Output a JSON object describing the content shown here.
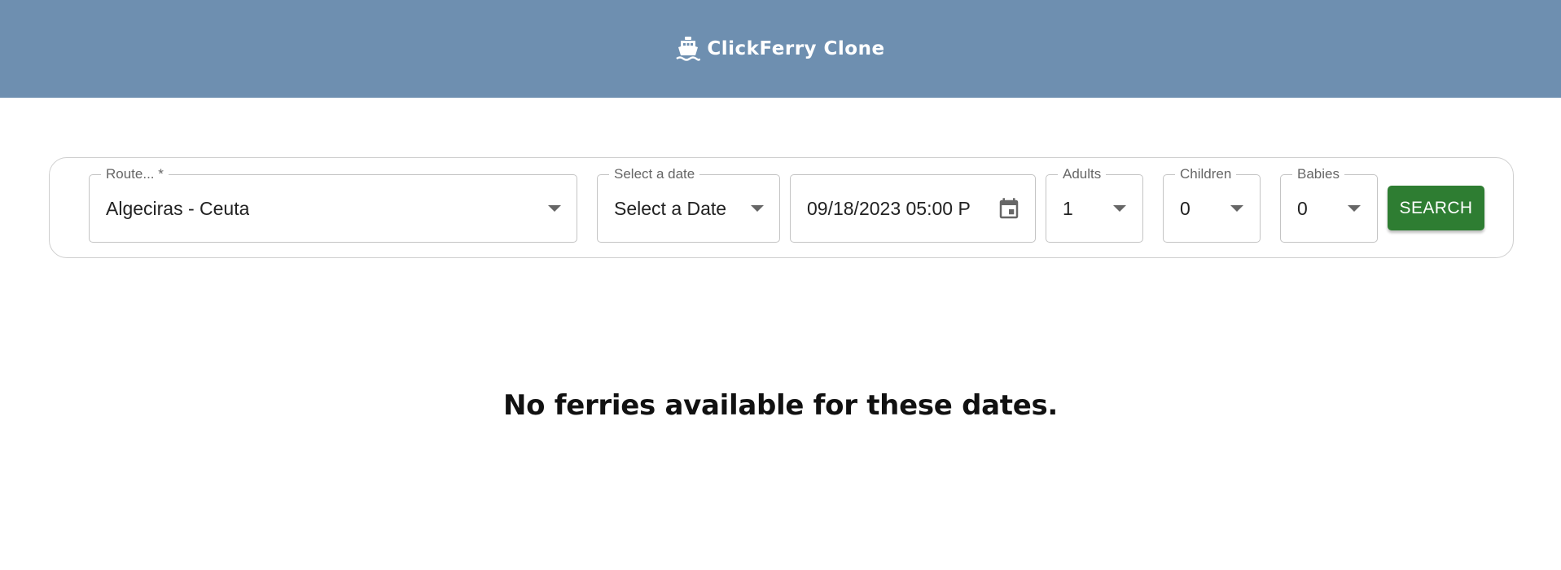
{
  "header": {
    "brand": "ClickFerry Clone",
    "brand_icon": "ferry-icon",
    "background_color": "#6e8fb0"
  },
  "search": {
    "route": {
      "label": "Route... *",
      "value": "Algeciras - Ceuta"
    },
    "date_select": {
      "label": "Select a date",
      "value": "Select a Date"
    },
    "datetime": {
      "value": "09/18/2023 05:00 P",
      "icon": "calendar-icon"
    },
    "adults": {
      "label": "Adults",
      "value": "1"
    },
    "children": {
      "label": "Children",
      "value": "0"
    },
    "babies": {
      "label": "Babies",
      "value": "0"
    },
    "button_label": "SEARCH",
    "button_color": "#2e7d32"
  },
  "results": {
    "empty_message": "No ferries available for these dates."
  }
}
